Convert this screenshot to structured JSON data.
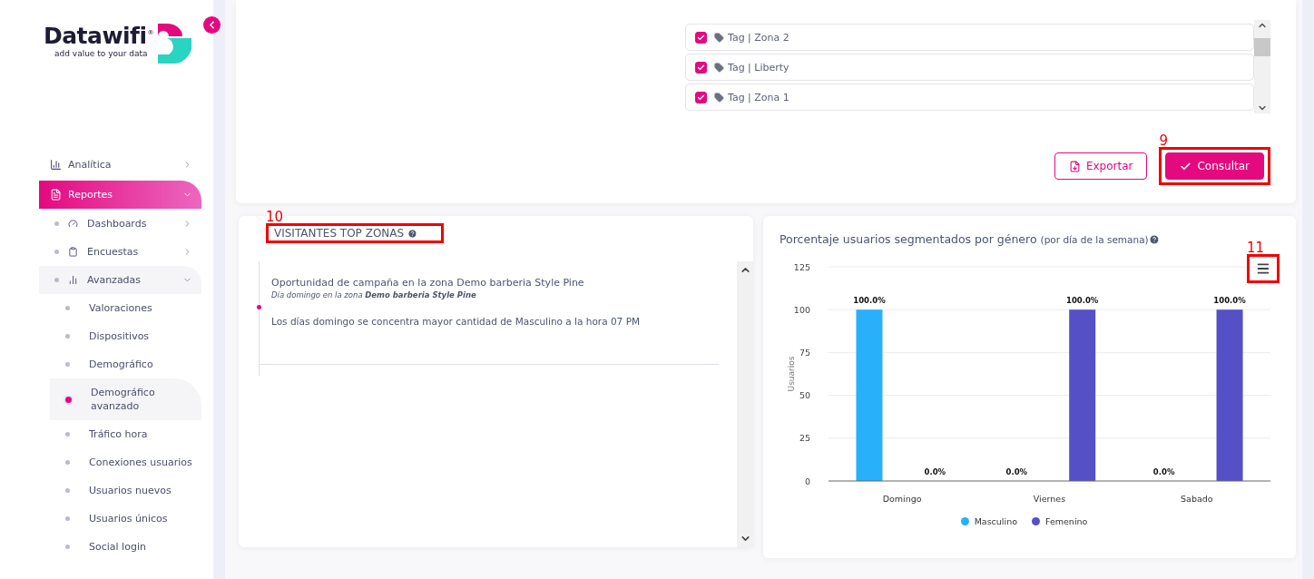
{
  "sidebar": {
    "logo": {
      "name": "Datawifi",
      "mark": "®",
      "tagline": "add value to your data"
    },
    "items": [
      {
        "label": "Analítica",
        "selected": false,
        "expanded": false
      },
      {
        "label": "Reportes",
        "selected": true,
        "expanded": true,
        "children": [
          {
            "label": "Dashboards",
            "selected": false,
            "expanded": false
          },
          {
            "label": "Encuestas",
            "selected": false,
            "expanded": false
          },
          {
            "label": "Avanzadas",
            "selected": false,
            "expanded": true,
            "children": [
              {
                "label": "Valoraciones",
                "selected": false
              },
              {
                "label": "Dispositivos",
                "selected": false
              },
              {
                "label": "Demográfico",
                "selected": false
              },
              {
                "label": "Demográfico avanzado",
                "selected": true
              },
              {
                "label": "Tráfico hora",
                "selected": false
              },
              {
                "label": "Conexiones usuarios",
                "selected": false
              },
              {
                "label": "Usuarios nuevos",
                "selected": false
              },
              {
                "label": "Usuarios únicos",
                "selected": false
              },
              {
                "label": "Social login",
                "selected": false
              }
            ]
          }
        ]
      }
    ]
  },
  "filters": {
    "tags": [
      {
        "label": "Tag | Zona 2",
        "checked": true
      },
      {
        "label": "Tag | Liberty",
        "checked": true
      },
      {
        "label": "Tag | Zona 1",
        "checked": true
      }
    ],
    "buttons": [
      {
        "label": "Exportar",
        "kind": "outline"
      },
      {
        "label": "Consultar",
        "kind": "primary",
        "callout": "9"
      }
    ]
  },
  "insights": {
    "title": "VISITANTES TOP ZONAS",
    "callout": "10",
    "items": [
      {
        "title": "Oportunidad de campaña en la zona Demo barberia Style Pine",
        "subtitle": "Día domingo en la zona **Demo barberia Style Pine**",
        "body": "Los días domingo se concentra mayor cantidad de Masculino a la hora 07 PM"
      }
    ]
  },
  "gender_chart": {
    "title": "Porcentaje usuarios segmentados por género",
    "title_note": "(por día de la semana)",
    "menu_callout": "11",
    "chart_data": {
      "type": "bar",
      "ylabel": "Usuarios",
      "categories": [
        "Domingo",
        "Viernes",
        "Sabado"
      ],
      "series": [
        {
          "name": "Masculino",
          "color": "#29b0fb",
          "values": [
            100,
            0,
            0
          ]
        },
        {
          "name": "Femenino",
          "color": "#5550c6",
          "values": [
            0,
            100,
            100
          ]
        }
      ],
      "grid": true,
      "ylim": [
        0,
        125
      ],
      "yticks": [
        0,
        25,
        50,
        75,
        100,
        125
      ],
      "value_labels": [
        [
          "100.0%",
          "0.0%",
          "0.0%"
        ],
        [
          "0.0%",
          "100.0%",
          "100.0%"
        ]
      ]
    }
  }
}
